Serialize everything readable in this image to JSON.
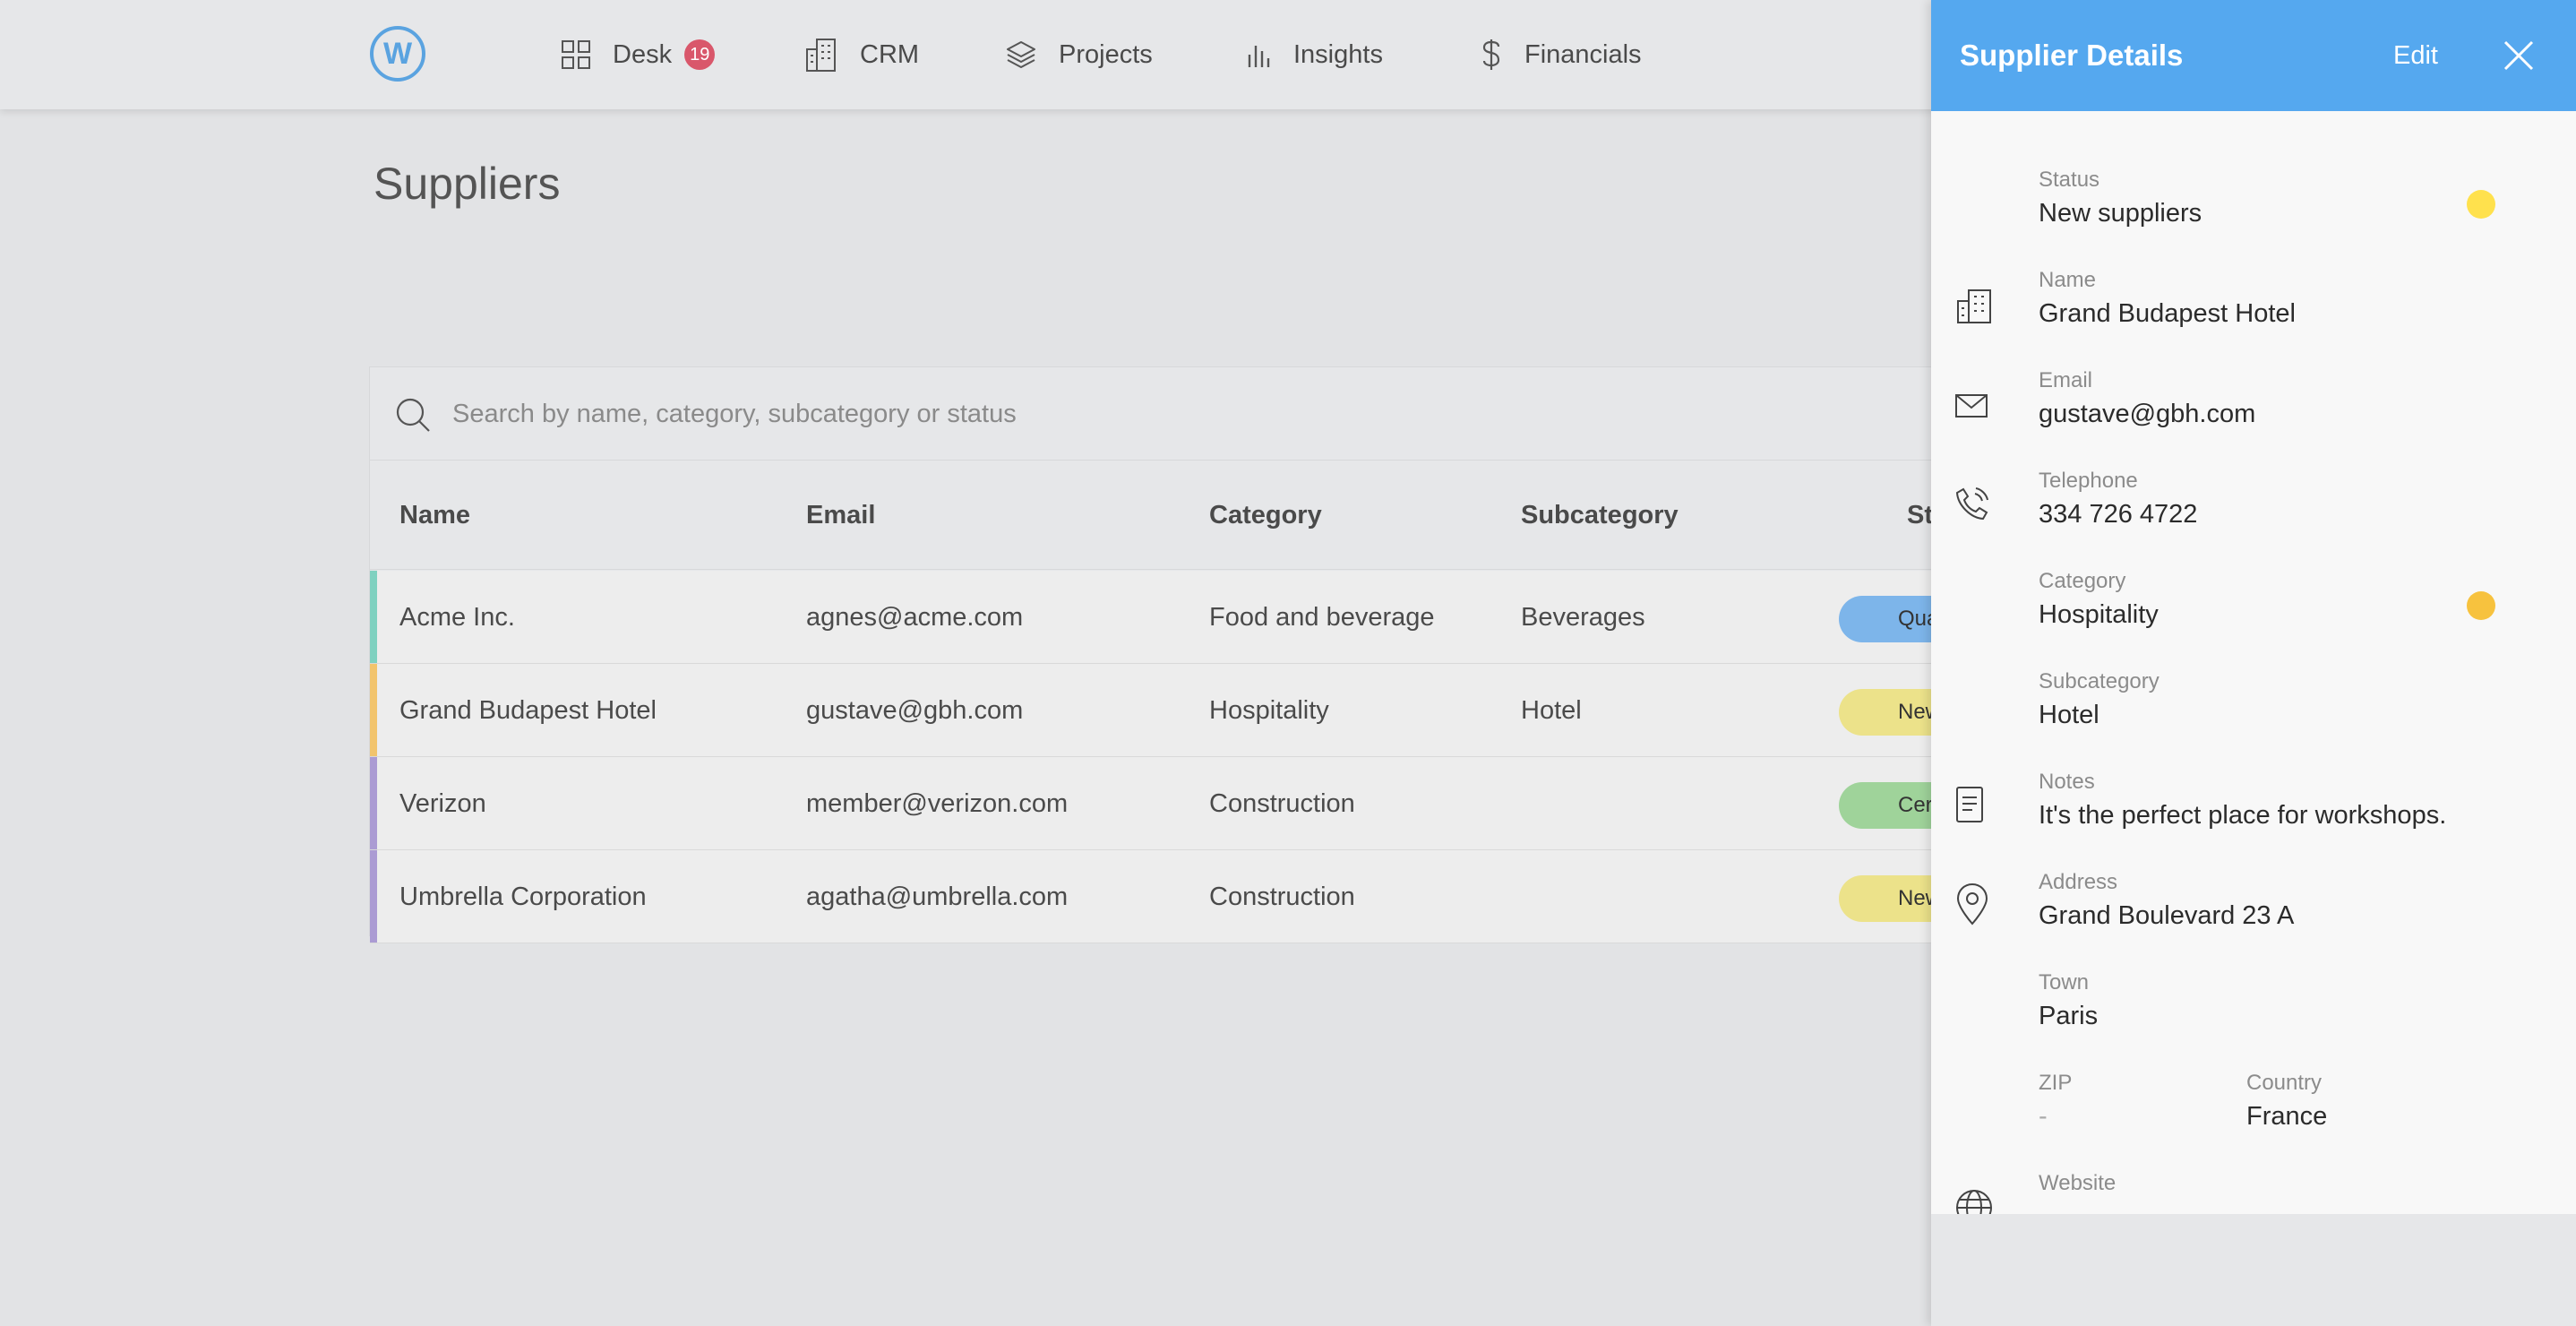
{
  "nav": {
    "logo_letter": "W",
    "items": [
      {
        "label": "Desk",
        "icon": "grid-icon",
        "badge": "19"
      },
      {
        "label": "CRM",
        "icon": "building-icon"
      },
      {
        "label": "Projects",
        "icon": "layers-icon"
      },
      {
        "label": "Insights",
        "icon": "bar-chart-icon"
      },
      {
        "label": "Financials",
        "icon": "dollar-icon"
      }
    ]
  },
  "page": {
    "title": "Suppliers"
  },
  "search": {
    "placeholder": "Search by name, category, subcategory or status",
    "value": ""
  },
  "table": {
    "columns": [
      "Name",
      "Email",
      "Category",
      "Subcategory",
      "Status"
    ],
    "rows": [
      {
        "name": "Acme Inc.",
        "email": "agnes@acme.com",
        "category": "Food and beverage",
        "subcategory": "Beverages",
        "status": "Qualified",
        "stripe_color": "#7fd1c0",
        "pill_color": "#7db5ea"
      },
      {
        "name": "Grand Budapest Hotel",
        "email": "gustave@gbh.com",
        "category": "Hospitality",
        "subcategory": "Hotel",
        "status": "New suppliers",
        "stripe_color": "#f2c46d",
        "pill_color": "#ece28a"
      },
      {
        "name": "Verizon",
        "email": "member@verizon.com",
        "category": "Construction",
        "subcategory": "",
        "status": "Certified",
        "stripe_color": "#ab9bd3",
        "pill_color": "#9fd39a"
      },
      {
        "name": "Umbrella Corporation",
        "email": "agatha@umbrella.com",
        "category": "Construction",
        "subcategory": "",
        "status": "New suppliers",
        "stripe_color": "#ab9bd3",
        "pill_color": "#ece28a"
      }
    ]
  },
  "panel": {
    "title": "Supplier Details",
    "edit_label": "Edit",
    "fields": {
      "status": {
        "label": "Status",
        "value": "New suppliers",
        "dot_color": "#ffe14d"
      },
      "name": {
        "label": "Name",
        "value": "Grand Budapest Hotel"
      },
      "email": {
        "label": "Email",
        "value": "gustave@gbh.com"
      },
      "telephone": {
        "label": "Telephone",
        "value": "334 726 4722"
      },
      "category": {
        "label": "Category",
        "value": "Hospitality",
        "dot_color": "#f7c23e"
      },
      "subcategory": {
        "label": "Subcategory",
        "value": "Hotel"
      },
      "notes": {
        "label": "Notes",
        "value": "It's the perfect place for workshops."
      },
      "address": {
        "label": "Address",
        "value": "Grand Boulevard 23 A"
      },
      "town": {
        "label": "Town",
        "value": "Paris"
      },
      "zip": {
        "label": "ZIP",
        "value": "-"
      },
      "country": {
        "label": "Country",
        "value": "France"
      },
      "website": {
        "label": "Website"
      }
    }
  }
}
